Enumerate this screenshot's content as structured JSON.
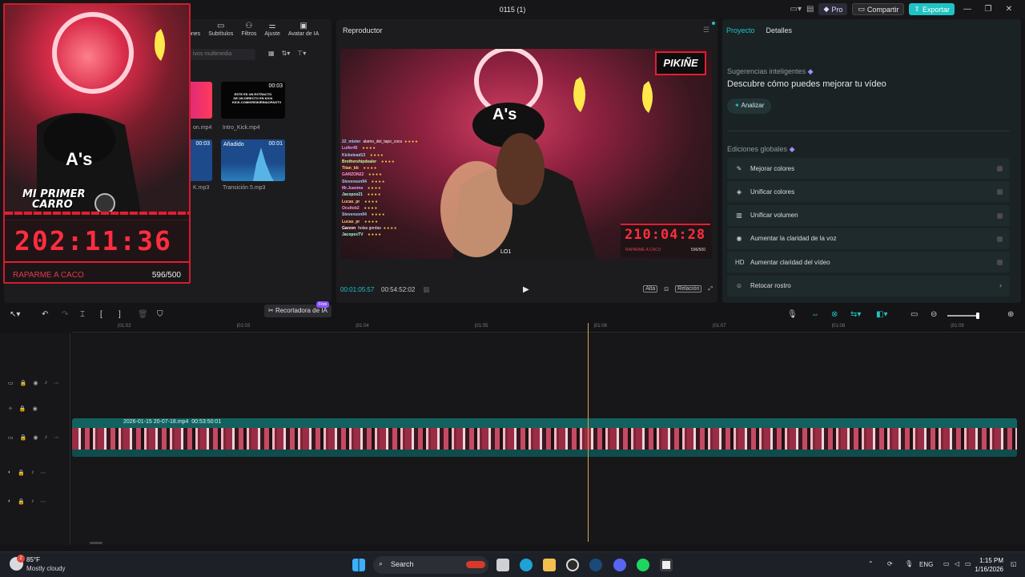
{
  "window": {
    "title": "0115 (1)",
    "pro_label": "Pro",
    "share_label": "Compartir",
    "export_label": "Exportar"
  },
  "media": {
    "tabs": [
      "ones",
      "Subtítulos",
      "Filtros",
      "Ajuste",
      "Avatar de IA"
    ],
    "search_placeholder": "ivos multimedia",
    "items": [
      {
        "name": "on.mp4",
        "duration": ""
      },
      {
        "name": "Intro_Kick.mp4",
        "duration": "00:03"
      },
      {
        "name": "K.mp3",
        "duration": "00:03"
      },
      {
        "name": "Transición 5.mp3",
        "duration": "00:01",
        "badge": "Añadido"
      }
    ],
    "intro_thumb_text": "ESTE ES UN EXTRACTO DE UN DIRECTO EN KICK KICK.COM/KRISKIRINAOPAGTV",
    "ai_cutter_label": "Recortadora de IA",
    "free_badge": "Free"
  },
  "overlay": {
    "title_line1": "MI PRIMER",
    "title_line2": "CARRO",
    "timer": "202:11:36",
    "footer_left": "RAPARME A CACO",
    "footer_right": "596/500"
  },
  "player": {
    "title": "Reproductor",
    "brand": "PIKIÑE",
    "timer": "210:04:28",
    "timer_left": "RAPARME A CACO",
    "timer_right": "596/500",
    "lo1": "LO1",
    "chat": [
      {
        "user": "22_mister",
        "msg": "alamo_del_tapo_cocu",
        "color": "#9ad4ff"
      },
      {
        "user": "Luifer45",
        "msg": "",
        "color": "#c7a8ff"
      },
      {
        "user": "Kickstead13",
        "msg": "",
        "color": "#9ad4ff"
      },
      {
        "user": "Brothershipdealer",
        "msg": "",
        "color": "#c7ff9a"
      },
      {
        "user": "Titan_bb",
        "msg": "",
        "color": "#ffd27a"
      },
      {
        "user": "GARZON22",
        "msg": "",
        "color": "#ff9ad4"
      },
      {
        "user": "Stevenson94",
        "msg": "",
        "color": "#9ad4ff"
      },
      {
        "user": "Mr.Juanma",
        "msg": "",
        "color": "#c7a8ff"
      },
      {
        "user": "Jacopox21",
        "msg": "",
        "color": "#9affe0"
      },
      {
        "user": "Lucas_pr",
        "msg": "",
        "color": "#ffd27a"
      },
      {
        "user": "Ocultob2",
        "msg": "",
        "color": "#ff9ad4"
      },
      {
        "user": "Stevenson94",
        "msg": "",
        "color": "#9ad4ff"
      },
      {
        "user": "Lucas_pr",
        "msg": "",
        "color": "#ffd27a"
      },
      {
        "user": "Garzon",
        "msg": "holas gordas",
        "color": "#ffffff"
      },
      {
        "user": "JacopexTV",
        "msg": "",
        "color": "#9affe0"
      }
    ],
    "time_current": "00:01:05:57",
    "time_total": "00:54:52:02",
    "ctrl_quality": "Alta",
    "ctrl_ratio": "Relación"
  },
  "props": {
    "tab_project": "Proyecto",
    "tab_details": "Detalles",
    "smart_title": "Sugerencias inteligentes",
    "smart_headline": "Descubre cómo puedes mejorar tu vídeo",
    "analyze_label": "Analizar",
    "global_title": "Ediciones globales",
    "options": [
      {
        "icon": "wand-icon",
        "glyph": "✎",
        "label": "Mejorar colores",
        "type": "toggle"
      },
      {
        "icon": "palette-icon",
        "glyph": "◈",
        "label": "Unificar colores",
        "type": "toggle"
      },
      {
        "icon": "volume-icon",
        "glyph": "▥",
        "label": "Unificar volumen",
        "type": "toggle"
      },
      {
        "icon": "voice-icon",
        "glyph": "◉",
        "label": "Aumentar la claridad de la voz",
        "type": "toggle"
      },
      {
        "icon": "hd-icon",
        "glyph": "HD",
        "label": "Aumentar claridad del vídeo",
        "type": "toggle"
      },
      {
        "icon": "face-icon",
        "glyph": "☺",
        "label": "Retocar rostro",
        "type": "link"
      }
    ]
  },
  "timeline": {
    "ruler": [
      "|01:02",
      "|01:03",
      "|01:04",
      "|01:05",
      "|01:06",
      "|01:07",
      "|01:08",
      "|01:09"
    ],
    "clip_name": "2026-01-15 20-07-18.mp4",
    "clip_duration": "00:53:50:01"
  },
  "taskbar": {
    "weather_temp": "85°F",
    "weather_desc": "Mostly cloudy",
    "weather_badge": "2",
    "search_label": "Search",
    "lang": "ENG",
    "time": "1:15 PM",
    "date": "1/16/2026"
  },
  "colors": {
    "accent": "#20c3c3",
    "overlay_red": "#e31e32",
    "timer_red": "#ff2d3f",
    "clip": "#11625f",
    "playhead": "#d6a64a"
  }
}
